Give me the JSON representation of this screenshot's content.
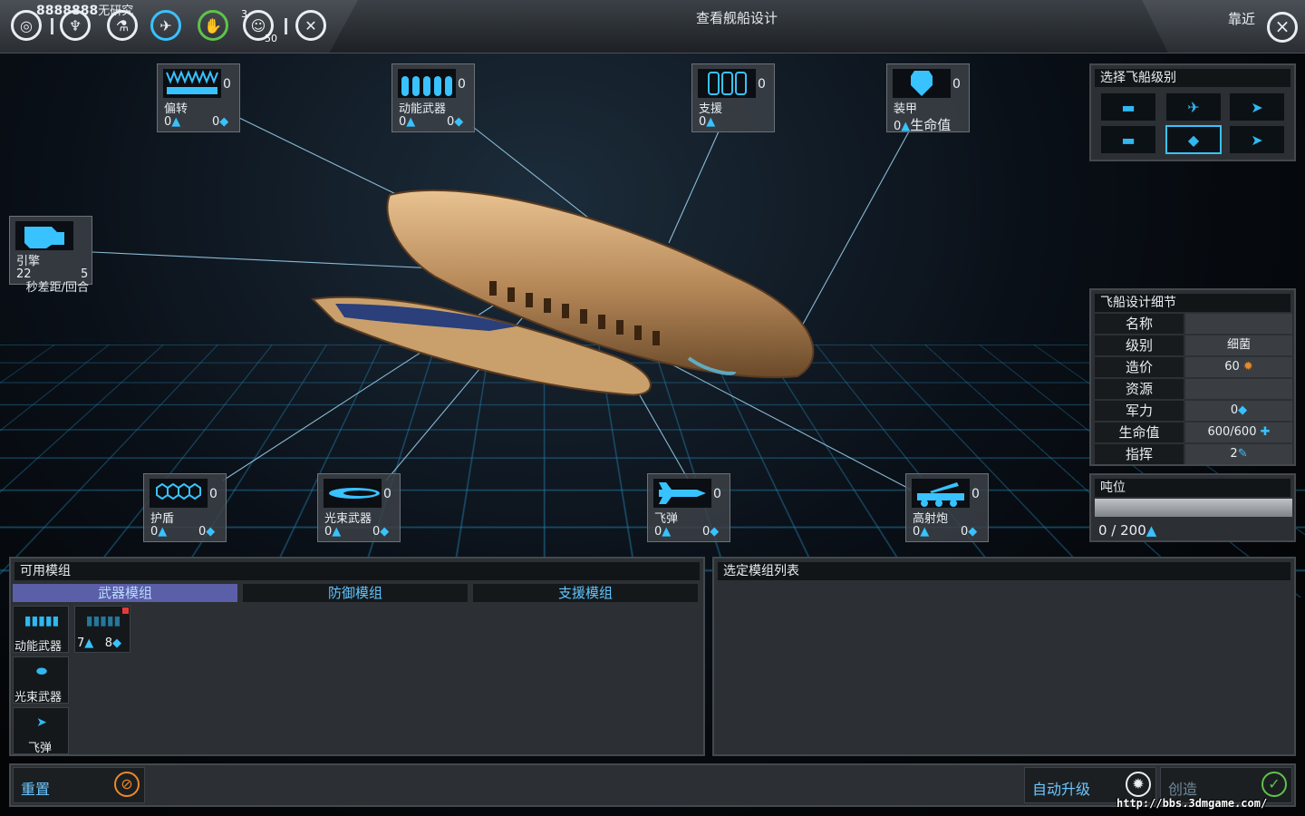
{
  "topbar": {
    "research_value": "8888888",
    "research_label": "无研究",
    "counter_a": "3",
    "counter_b": "50",
    "title": "查看舰船设计",
    "zoom_label": "靠近"
  },
  "modules_on_ship": [
    {
      "key": "deflect",
      "label": "偏转",
      "count": "0",
      "a": "0",
      "b": "0"
    },
    {
      "key": "kinetic",
      "label": "动能武器",
      "count": "0",
      "a": "0",
      "b": "0"
    },
    {
      "key": "support",
      "label": "支援",
      "count": "0",
      "a": "0"
    },
    {
      "key": "armor",
      "label": "装甲",
      "count": "0",
      "a": "0",
      "b": "生命值"
    },
    {
      "key": "engine",
      "label": "引擎",
      "a": "22",
      "b": "5",
      "sub": "秒差距/回合"
    },
    {
      "key": "shield",
      "label": "护盾",
      "count": "0",
      "a": "0",
      "b": "0"
    },
    {
      "key": "beam",
      "label": "光束武器",
      "count": "0",
      "a": "0",
      "b": "0"
    },
    {
      "key": "missile",
      "label": "飞弹",
      "count": "0",
      "a": "0",
      "b": "0"
    },
    {
      "key": "artillery",
      "label": "高射炮",
      "count": "0",
      "a": "0",
      "b": "0"
    }
  ],
  "class_panel": {
    "title": "选择飞船级别"
  },
  "details": {
    "title": "飞船设计细节",
    "rows": [
      {
        "k": "名称",
        "v": ""
      },
      {
        "k": "级别",
        "v": "细菌"
      },
      {
        "k": "造价",
        "v": "60"
      },
      {
        "k": "资源",
        "v": ""
      },
      {
        "k": "军力",
        "v": "0"
      },
      {
        "k": "生命值",
        "v": "600/600"
      },
      {
        "k": "指挥",
        "v": "2"
      }
    ]
  },
  "tonnage": {
    "title": "吨位",
    "value": "0 / 200",
    "fill": 0
  },
  "available": {
    "title": "可用模组",
    "tabs": [
      "武器模组",
      "防御模组",
      "支援模组"
    ],
    "items": [
      {
        "label": "动能武器"
      },
      {
        "label": "",
        "a": "7",
        "b": "8"
      },
      {
        "label": "光束武器"
      },
      {
        "label": "飞弹"
      }
    ]
  },
  "selected": {
    "title": "选定模组列表"
  },
  "buttons": {
    "reset": "重置",
    "auto": "自动升级",
    "create": "创造"
  },
  "watermark": "http://bbs.3dmgame.com/",
  "colors": {
    "accent": "#38c2ff",
    "tab_active": "#5b5fa8",
    "create_icon": "#5fc24a",
    "reset_icon": "#e88a2a"
  }
}
